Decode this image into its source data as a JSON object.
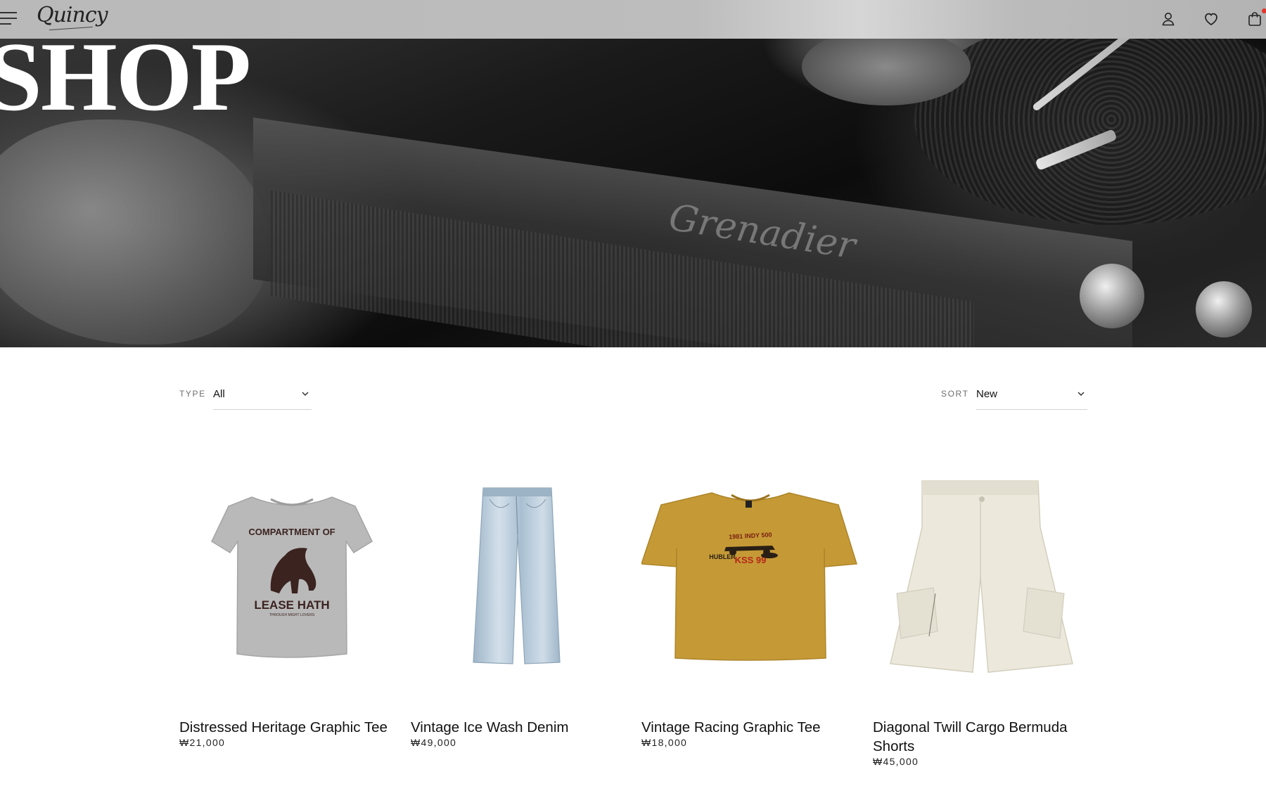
{
  "header": {
    "logo_text": "Quincy",
    "icons": [
      "menu-icon",
      "account-icon",
      "wishlist-heart-icon",
      "cart-bag-icon"
    ]
  },
  "hero": {
    "title": "SHOP",
    "background_text": "Grenadier"
  },
  "filters": {
    "type": {
      "label": "TYPE",
      "value": "All"
    },
    "sort": {
      "label": "SORT",
      "value": "New"
    }
  },
  "products": [
    {
      "name": "Distressed Heritage Graphic Tee",
      "price": "₩21,000",
      "print_top": "COMPARTMENT OF",
      "print_bottom": "LEASE HATH",
      "print_tiny": "THROUGH MIGHT LOVERS"
    },
    {
      "name": "Vintage Ice Wash Denim",
      "price": "₩49,000"
    },
    {
      "name": "Vintage Racing Graphic Tee",
      "price": "₩18,000",
      "print_top": "1981 INDY 500",
      "print_left": "HUBLER",
      "print_red": "KSS 99"
    },
    {
      "name": "Diagonal Twill Cargo Bermuda Shorts",
      "price": "₩45,000"
    }
  ],
  "colors": {
    "header_bg": "#bcbcbc",
    "cart_dot": "#e0362c",
    "tee_grey": "#b9b9b9",
    "denim": "#aec3d4",
    "tee_mustard": "#c59a36",
    "shorts_cream": "#ece9dc"
  }
}
